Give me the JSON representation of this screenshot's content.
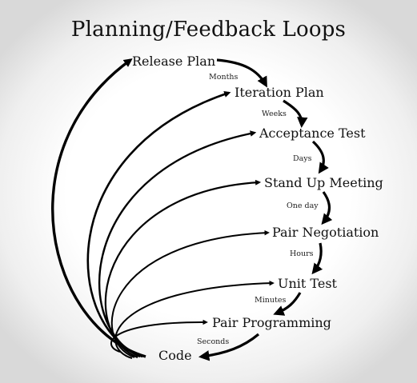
{
  "title": "Planning/Feedback Loops",
  "nodes": [
    {
      "key": "release",
      "label": "Release Plan"
    },
    {
      "key": "iteration",
      "label": "Iteration Plan"
    },
    {
      "key": "acceptance",
      "label": "Acceptance Test"
    },
    {
      "key": "standup",
      "label": "Stand Up Meeting"
    },
    {
      "key": "negotiation",
      "label": "Pair Negotiation"
    },
    {
      "key": "unittest",
      "label": "Unit Test"
    },
    {
      "key": "pairprog",
      "label": "Pair Programming"
    },
    {
      "key": "code",
      "label": "Code"
    }
  ],
  "timescales": [
    "Months",
    "Weeks",
    "Days",
    "One day",
    "Hours",
    "Minutes",
    "Seconds"
  ]
}
